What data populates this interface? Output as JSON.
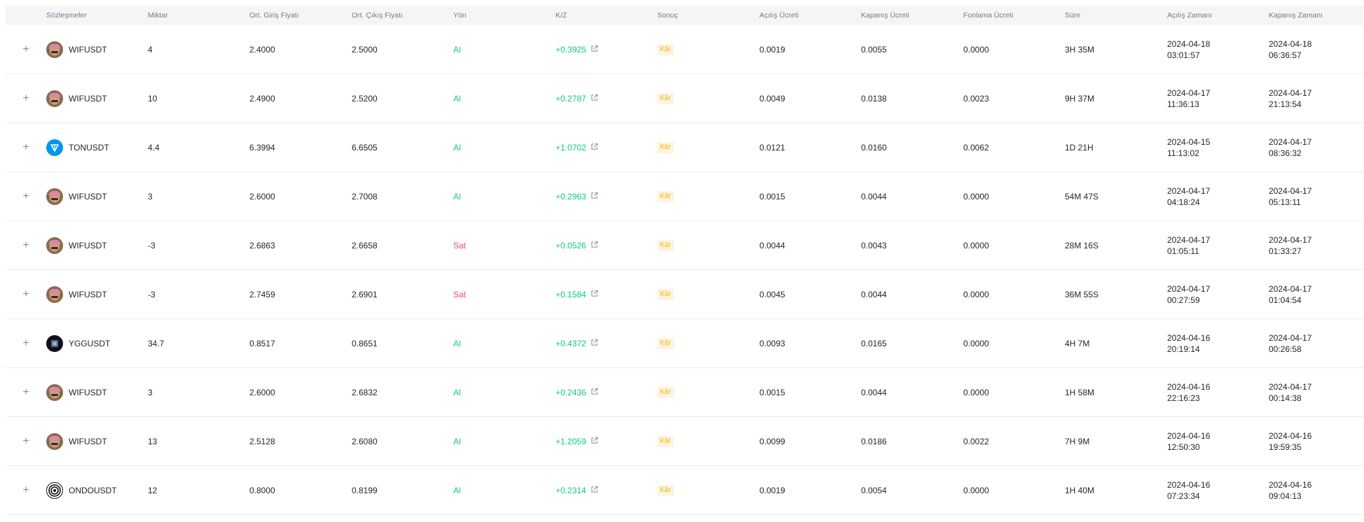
{
  "headers": [
    "Sözleşmeler",
    "Miktar",
    "Ort. Giriş Fiyatı",
    "Ort. Çıkış Fiyatı",
    "Yön",
    "K/Z",
    "Sonuç",
    "Açılış Ücreti",
    "Kapanış Ücreti",
    "Fonlama Ücreti",
    "Süre",
    "Açılış Zamanı",
    "Kapanış Zamanı"
  ],
  "expand_symbol": "+",
  "rows": [
    {
      "coin": "wif",
      "symbol": "WIFUSDT",
      "qty": "4",
      "entry": "2.4000",
      "exit": "2.5000",
      "side": "Al",
      "side_type": "buy",
      "pnl": "+0.3925",
      "result": "Kâr",
      "open_fee": "0.0019",
      "close_fee": "0.0055",
      "funding_fee": "0.0000",
      "duration": "3H 35M",
      "open_date": "2024-04-18",
      "open_time": "03:01:57",
      "close_date": "2024-04-18",
      "close_time": "06:36:57"
    },
    {
      "coin": "wif",
      "symbol": "WIFUSDT",
      "qty": "10",
      "entry": "2.4900",
      "exit": "2.5200",
      "side": "Al",
      "side_type": "buy",
      "pnl": "+0.2787",
      "result": "Kâr",
      "open_fee": "0.0049",
      "close_fee": "0.0138",
      "funding_fee": "0.0023",
      "duration": "9H 37M",
      "open_date": "2024-04-17",
      "open_time": "11:36:13",
      "close_date": "2024-04-17",
      "close_time": "21:13:54"
    },
    {
      "coin": "ton",
      "symbol": "TONUSDT",
      "qty": "4.4",
      "entry": "6.3994",
      "exit": "6.6505",
      "side": "Al",
      "side_type": "buy",
      "pnl": "+1.0702",
      "result": "Kâr",
      "open_fee": "0.0121",
      "close_fee": "0.0160",
      "funding_fee": "0.0062",
      "duration": "1D 21H",
      "open_date": "2024-04-15",
      "open_time": "11:13:02",
      "close_date": "2024-04-17",
      "close_time": "08:36:32"
    },
    {
      "coin": "wif",
      "symbol": "WIFUSDT",
      "qty": "3",
      "entry": "2.6000",
      "exit": "2.7008",
      "side": "Al",
      "side_type": "buy",
      "pnl": "+0.2963",
      "result": "Kâr",
      "open_fee": "0.0015",
      "close_fee": "0.0044",
      "funding_fee": "0.0000",
      "duration": "54M 47S",
      "open_date": "2024-04-17",
      "open_time": "04:18:24",
      "close_date": "2024-04-17",
      "close_time": "05:13:11"
    },
    {
      "coin": "wif",
      "symbol": "WIFUSDT",
      "qty": "-3",
      "entry": "2.6863",
      "exit": "2.6658",
      "side": "Sat",
      "side_type": "sell",
      "pnl": "+0.0526",
      "result": "Kâr",
      "open_fee": "0.0044",
      "close_fee": "0.0043",
      "funding_fee": "0.0000",
      "duration": "28M 16S",
      "open_date": "2024-04-17",
      "open_time": "01:05:11",
      "close_date": "2024-04-17",
      "close_time": "01:33:27"
    },
    {
      "coin": "wif",
      "symbol": "WIFUSDT",
      "qty": "-3",
      "entry": "2.7459",
      "exit": "2.6901",
      "side": "Sat",
      "side_type": "sell",
      "pnl": "+0.1584",
      "result": "Kâr",
      "open_fee": "0.0045",
      "close_fee": "0.0044",
      "funding_fee": "0.0000",
      "duration": "36M 55S",
      "open_date": "2024-04-17",
      "open_time": "00:27:59",
      "close_date": "2024-04-17",
      "close_time": "01:04:54"
    },
    {
      "coin": "ygg",
      "symbol": "YGGUSDT",
      "qty": "34.7",
      "entry": "0.8517",
      "exit": "0.8651",
      "side": "Al",
      "side_type": "buy",
      "pnl": "+0.4372",
      "result": "Kâr",
      "open_fee": "0.0093",
      "close_fee": "0.0165",
      "funding_fee": "0.0000",
      "duration": "4H 7M",
      "open_date": "2024-04-16",
      "open_time": "20:19:14",
      "close_date": "2024-04-17",
      "close_time": "00:26:58"
    },
    {
      "coin": "wif",
      "symbol": "WIFUSDT",
      "qty": "3",
      "entry": "2.6000",
      "exit": "2.6832",
      "side": "Al",
      "side_type": "buy",
      "pnl": "+0.2436",
      "result": "Kâr",
      "open_fee": "0.0015",
      "close_fee": "0.0044",
      "funding_fee": "0.0000",
      "duration": "1H 58M",
      "open_date": "2024-04-16",
      "open_time": "22:16:23",
      "close_date": "2024-04-17",
      "close_time": "00:14:38"
    },
    {
      "coin": "wif",
      "symbol": "WIFUSDT",
      "qty": "13",
      "entry": "2.5128",
      "exit": "2.6080",
      "side": "Al",
      "side_type": "buy",
      "pnl": "+1.2059",
      "result": "Kâr",
      "open_fee": "0.0099",
      "close_fee": "0.0186",
      "funding_fee": "0.0022",
      "duration": "7H 9M",
      "open_date": "2024-04-16",
      "open_time": "12:50:30",
      "close_date": "2024-04-16",
      "close_time": "19:59:35"
    },
    {
      "coin": "ondo",
      "symbol": "ONDOUSDT",
      "qty": "12",
      "entry": "0.8000",
      "exit": "0.8199",
      "side": "Al",
      "side_type": "buy",
      "pnl": "+0.2314",
      "result": "Kâr",
      "open_fee": "0.0019",
      "close_fee": "0.0054",
      "funding_fee": "0.0000",
      "duration": "1H 40M",
      "open_date": "2024-04-16",
      "open_time": "07:23:34",
      "close_date": "2024-04-16",
      "close_time": "09:04:13"
    }
  ]
}
